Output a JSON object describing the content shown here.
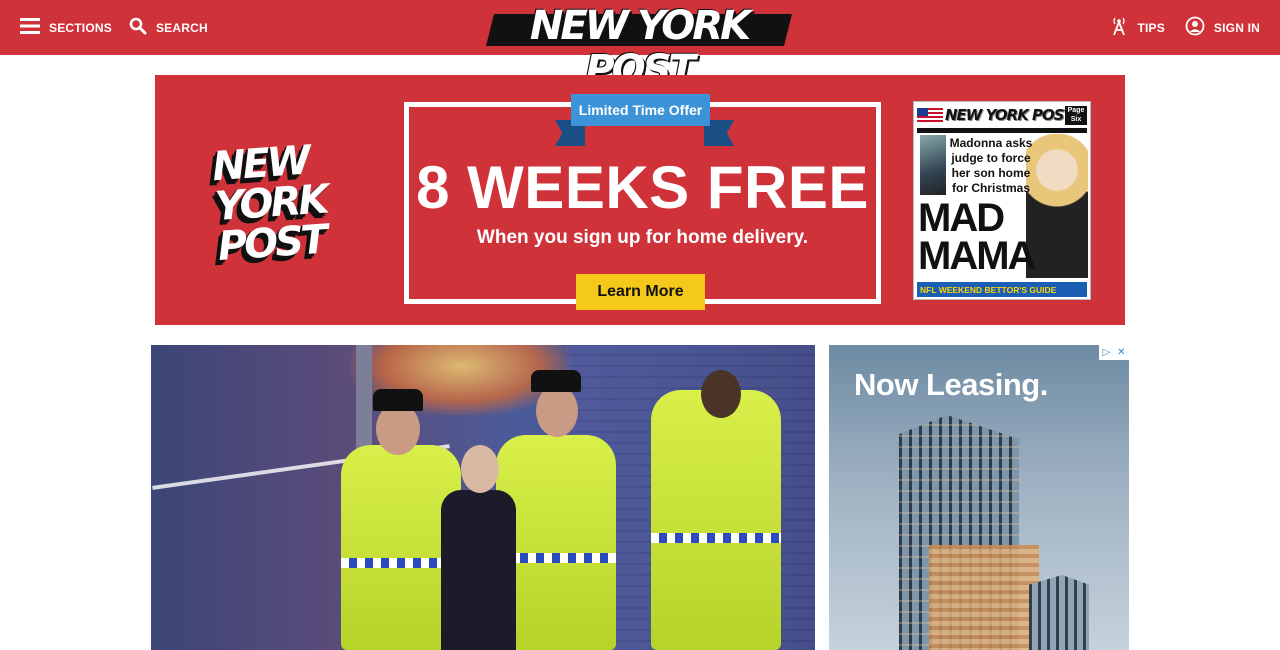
{
  "header": {
    "sections_label": "SECTIONS",
    "search_label": "SEARCH",
    "logo_text": "NEW YORK POST",
    "tips_label": "TIPS",
    "signin_label": "SIGN IN",
    "brand_color": "#d0323a"
  },
  "promo": {
    "logo_lines": [
      "NEW",
      "YORK",
      "POST"
    ],
    "ribbon": "Limited Time Offer",
    "headline": "8 WEEKS FREE",
    "subline": "When you sign up for home delivery.",
    "cta": "Learn More",
    "cover": {
      "masthead": "NEW YORK POST",
      "page_six": "Page Six",
      "headline": "Madonna asks judge to force her son home for Christmas",
      "big_lines": [
        "MAD",
        "MAMA"
      ],
      "footer": "NFL WEEKEND BETTOR'S GUIDE"
    }
  },
  "ad": {
    "text": "Now Leasing.",
    "choices_icons": [
      "adchoices-icon",
      "close-icon"
    ]
  },
  "icons": {
    "sections": "hamburger-menu-icon",
    "search": "search-icon",
    "tips": "broadcast-tower-icon",
    "signin": "user-circle-icon"
  }
}
